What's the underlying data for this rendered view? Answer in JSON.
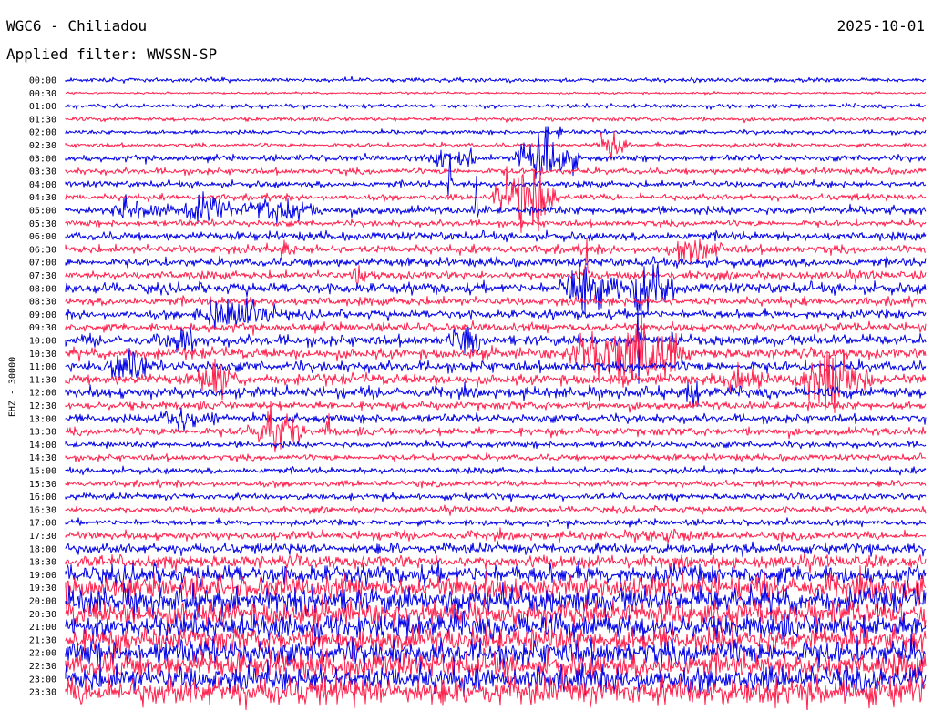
{
  "header": {
    "station": "WGC6 - Chiliadou",
    "date": "2025-10-01",
    "filter": "Applied filter: WWSSN-SP"
  },
  "chart_data": {
    "type": "line",
    "title": "WGC6 - Chiliadou",
    "ylabel": "EHZ - 30000",
    "colors": {
      "even_rows": "#0000e6",
      "odd_rows": "#ff1f4b"
    },
    "row_labels": [
      "00:00",
      "00:30",
      "01:00",
      "01:30",
      "02:00",
      "02:30",
      "03:00",
      "03:30",
      "04:00",
      "04:30",
      "05:00",
      "05:30",
      "06:00",
      "06:30",
      "07:00",
      "07:30",
      "08:00",
      "08:30",
      "09:00",
      "09:30",
      "10:00",
      "10:30",
      "11:00",
      "11:30",
      "12:00",
      "12:30",
      "13:00",
      "13:30",
      "14:00",
      "14:30",
      "15:00",
      "15:30",
      "16:00",
      "16:30",
      "17:00",
      "17:30",
      "18:00",
      "18:30",
      "19:00",
      "19:30",
      "20:00",
      "20:30",
      "21:00",
      "21:30",
      "22:00",
      "22:30",
      "23:00",
      "23:30"
    ],
    "noise_levels": [
      2,
      1,
      2,
      2,
      2,
      2,
      3,
      3,
      3,
      3,
      4,
      3,
      4,
      4,
      4,
      4,
      5,
      4,
      4,
      4,
      5,
      5,
      5,
      5,
      5,
      4,
      4,
      4,
      3,
      3,
      3,
      3,
      3,
      3,
      3,
      4,
      5,
      6,
      9,
      11,
      12,
      12,
      12,
      12,
      12,
      12,
      12,
      13
    ],
    "events": [
      {
        "row": 5,
        "start": 0.615,
        "end": 0.655,
        "amp": 22
      },
      {
        "row": 6,
        "start": 0.42,
        "end": 0.45,
        "amp": 12
      },
      {
        "row": 6,
        "start": 0.45,
        "end": 0.48,
        "amp": 10
      },
      {
        "row": 6,
        "start": 0.52,
        "end": 0.6,
        "amp": 30
      },
      {
        "row": 9,
        "start": 0.495,
        "end": 0.575,
        "amp": 38
      },
      {
        "row": 10,
        "start": 0.05,
        "end": 0.125,
        "amp": 12
      },
      {
        "row": 10,
        "start": 0.13,
        "end": 0.2,
        "amp": 14
      },
      {
        "row": 10,
        "start": 0.2,
        "end": 0.3,
        "amp": 12
      },
      {
        "row": 13,
        "start": 0.25,
        "end": 0.265,
        "amp": 10
      },
      {
        "row": 13,
        "start": 0.695,
        "end": 0.765,
        "amp": 12
      },
      {
        "row": 15,
        "start": 0.33,
        "end": 0.35,
        "amp": 8
      },
      {
        "row": 16,
        "start": 0.57,
        "end": 0.64,
        "amp": 32
      },
      {
        "row": 16,
        "start": 0.64,
        "end": 0.71,
        "amp": 22
      },
      {
        "row": 18,
        "start": 0.145,
        "end": 0.26,
        "amp": 16
      },
      {
        "row": 20,
        "start": 0.11,
        "end": 0.16,
        "amp": 10
      },
      {
        "row": 20,
        "start": 0.44,
        "end": 0.49,
        "amp": 10
      },
      {
        "row": 21,
        "start": 0.58,
        "end": 0.73,
        "amp": 40
      },
      {
        "row": 22,
        "start": 0.04,
        "end": 0.1,
        "amp": 16
      },
      {
        "row": 23,
        "start": 0.845,
        "end": 0.94,
        "amp": 34
      },
      {
        "row": 23,
        "start": 0.745,
        "end": 0.82,
        "amp": 14
      },
      {
        "row": 23,
        "start": 0.15,
        "end": 0.2,
        "amp": 20
      },
      {
        "row": 24,
        "start": 0.72,
        "end": 0.74,
        "amp": 14
      },
      {
        "row": 26,
        "start": 0.1,
        "end": 0.18,
        "amp": 10
      },
      {
        "row": 27,
        "start": 0.21,
        "end": 0.28,
        "amp": 24
      },
      {
        "row": 35,
        "start": 0.67,
        "end": 0.73,
        "amp": 6
      }
    ],
    "spikes": [
      {
        "row": 8,
        "x": 0.447,
        "amp": 70
      },
      {
        "row": 10,
        "x": 0.478,
        "amp": 60
      },
      {
        "row": 15,
        "x": 0.606,
        "amp": 48
      },
      {
        "row": 20,
        "x": 0.665,
        "amp": 90
      },
      {
        "row": 4,
        "x": 0.575,
        "amp": 30
      },
      {
        "row": 27,
        "x": 0.305,
        "amp": 30
      }
    ]
  }
}
